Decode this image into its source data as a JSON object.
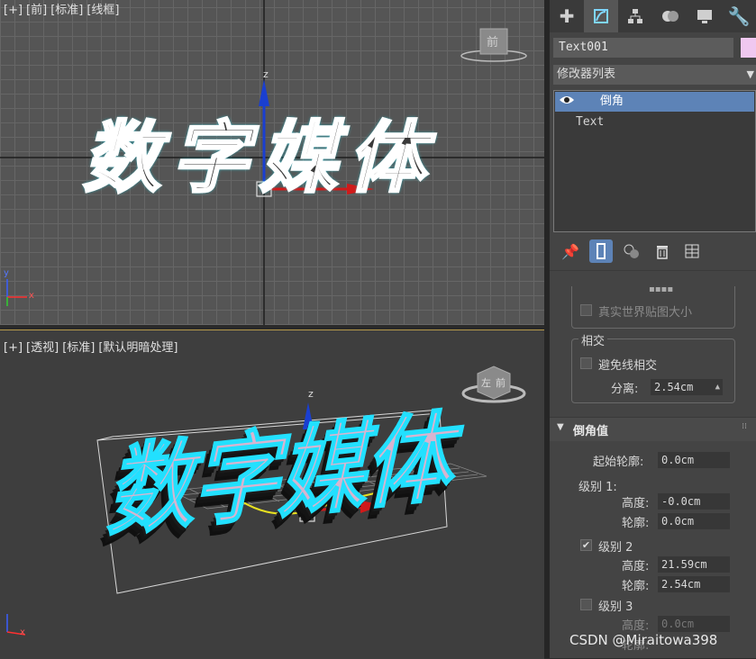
{
  "viewport_front": {
    "labels": [
      "[+]",
      "[前]",
      "[标准]",
      "[线框]"
    ],
    "viewcube_label": "前",
    "axis": {
      "y": "y",
      "z": "z",
      "x": "x"
    },
    "text_object": "数字媒体"
  },
  "viewport_persp": {
    "labels": [
      "[+]",
      "[透视]",
      "[标准]",
      "[默认明暗处理]"
    ],
    "viewcube_labels": [
      "左",
      "前"
    ],
    "axis": {
      "z": "z",
      "x": "x"
    }
  },
  "panel": {
    "tab_icons": [
      "create-icon",
      "modify-icon",
      "hierarchy-icon",
      "motion-icon",
      "display-icon",
      "utilities-icon"
    ],
    "object_name": "Text001",
    "object_color": "#f0c8f0",
    "modifier_list": "修改器列表",
    "stack": [
      {
        "label": "倒角",
        "selected": true
      },
      {
        "label": "Text",
        "selected": false
      }
    ],
    "realworld_map": "真实世界贴图大小",
    "intersect_group": "相交",
    "avoid_intersect": "避免线相交",
    "separation_label": "分离:",
    "separation_value": "2.54cm",
    "bevel_rollout": "倒角值",
    "start_outline_label": "起始轮廓:",
    "start_outline_value": "0.0cm",
    "level1_label": "级别 1:",
    "l1_height_label": "高度:",
    "l1_height_value": "-0.0cm",
    "l1_outline_label": "轮廓:",
    "l1_outline_value": "0.0cm",
    "level2_label": "级别 2",
    "l2_height_label": "高度:",
    "l2_height_value": "21.59cm",
    "l2_outline_label": "轮廓:",
    "l2_outline_value": "2.54cm",
    "level3_label": "级别 3",
    "l3_height_label": "高度:",
    "l3_height_value": "0.0cm",
    "l3_outline_label": "轮廓:"
  },
  "watermark": "CSDN @Miraitowa398"
}
